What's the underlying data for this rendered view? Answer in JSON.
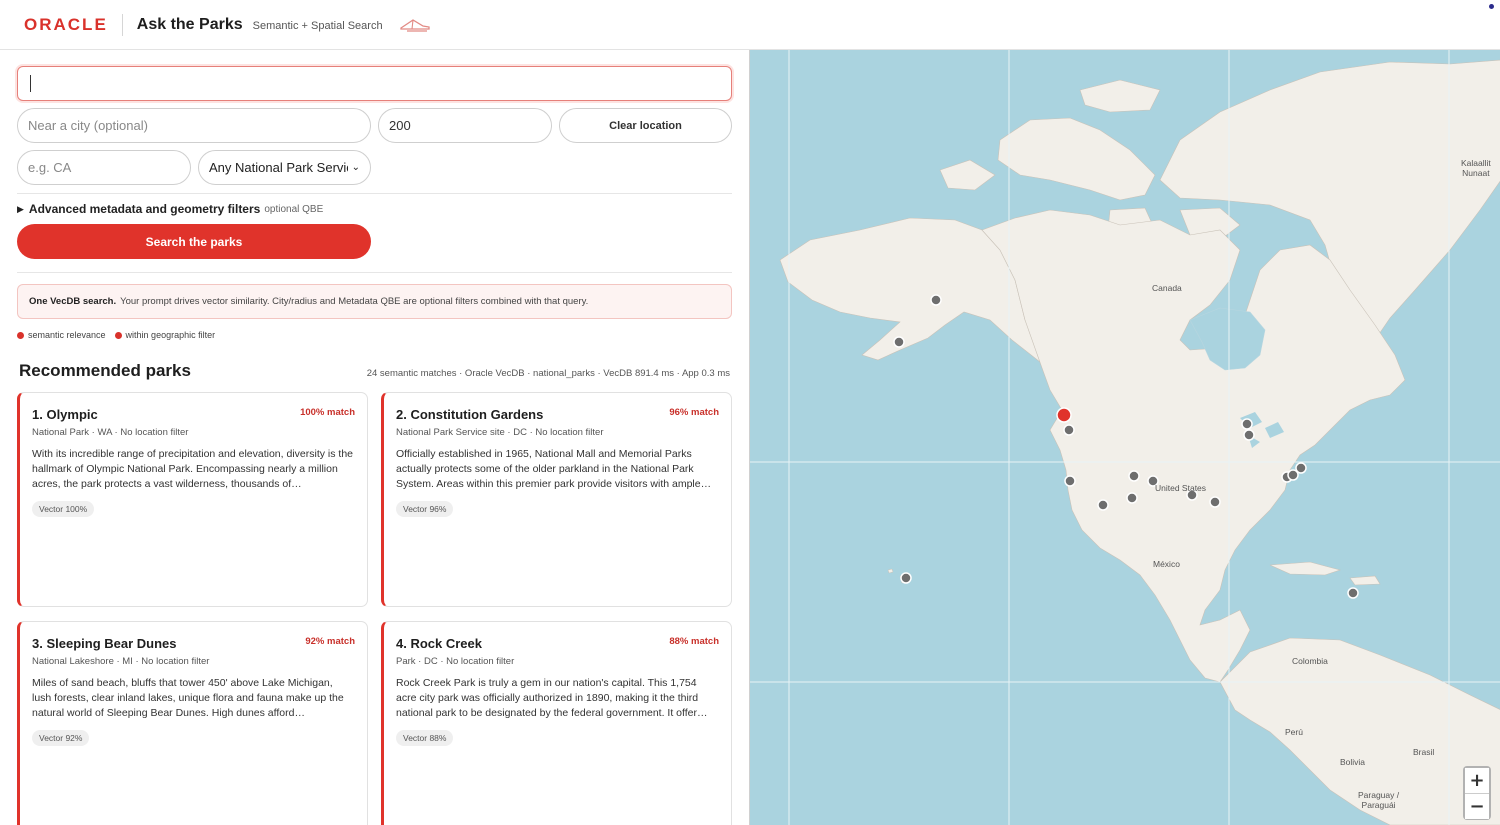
{
  "header": {
    "logo": "ORACLE",
    "title": "Ask the Parks",
    "subtitle": "Semantic + Spatial Search"
  },
  "search": {
    "prompt_value": "",
    "city_placeholder": "Near a city (optional)",
    "radius_value": "200",
    "clear_label": "Clear location",
    "state_placeholder": "e.g. CA",
    "designation_selected": "Any National Park Service",
    "advanced_label": "Advanced metadata and geometry filters",
    "advanced_optional": "optional QBE",
    "search_label": "Search the parks"
  },
  "note": {
    "bold": "One VecDB search.",
    "text": "Your prompt drives vector similarity. City/radius and Metadata QBE are optional filters combined with that query."
  },
  "legend": {
    "semantic": "semantic relevance",
    "geographic": "within geographic filter"
  },
  "results": {
    "title": "Recommended parks",
    "stats": "24 semantic matches · Oracle VecDB · national_parks · VecDB 891.4 ms · App 0.3 ms",
    "cards": [
      {
        "title": "1. Olympic",
        "match": "100% match",
        "meta": "National Park · WA · No location filter",
        "desc": "With its incredible range of precipitation and elevation, diversity is the hallmark of Olympic National Park. Encompassing nearly a million acres, the park protects a vast wilderness, thousands of…",
        "chip": "Vector 100%"
      },
      {
        "title": "2. Constitution Gardens",
        "match": "96% match",
        "meta": "National Park Service site · DC · No location filter",
        "desc": "Officially established in 1965, National Mall and Memorial Parks actually protects some of the older parkland in the National Park System. Areas within this premier park provide visitors with ample…",
        "chip": "Vector 96%"
      },
      {
        "title": "3. Sleeping Bear Dunes",
        "match": "92% match",
        "meta": "National Lakeshore · MI · No location filter",
        "desc": "Miles of sand beach, bluffs that tower 450' above Lake Michigan, lush forests, clear inland lakes, unique flora and fauna make up the natural world of Sleeping Bear Dunes. High dunes afford…",
        "chip": "Vector 92%"
      },
      {
        "title": "4. Rock Creek",
        "match": "88% match",
        "meta": "Park · DC · No location filter",
        "desc": "Rock Creek Park is truly a gem in our nation's capital. This 1,754 acre city park was officially authorized in 1890, making it the third national park to be designated by the federal government. It offer…",
        "chip": "Vector 88%"
      }
    ]
  },
  "map": {
    "labels": {
      "canada": "Canada",
      "united_states": "United States",
      "mexico": "México",
      "colombia": "Colombia",
      "peru": "Perú",
      "bolivia": "Bolivia",
      "brasil": "Brasil",
      "paraguay_1": "Paraguay /",
      "paraguay_2": "Paraguái",
      "kalaallit_1": "Kalaallit",
      "kalaallit_2": "Nunaat"
    },
    "zoom_in": "+",
    "zoom_out": "−"
  }
}
